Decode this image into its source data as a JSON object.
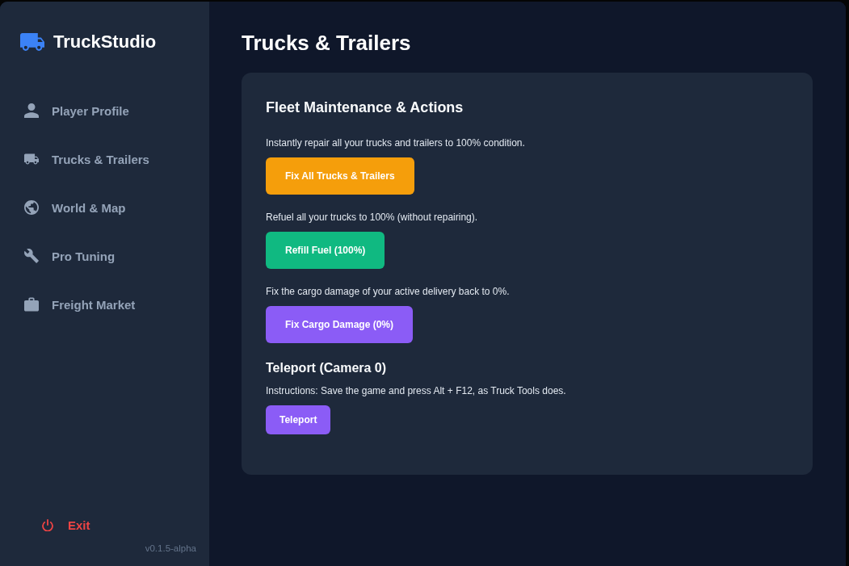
{
  "app": {
    "name": "TruckStudio",
    "version": "v0.1.5-alpha"
  },
  "sidebar": {
    "items": [
      {
        "label": "Player Profile",
        "selected": false
      },
      {
        "label": "Trucks & Trailers",
        "selected": false
      },
      {
        "label": "World & Map",
        "selected": false
      },
      {
        "label": "Pro Tuning",
        "selected": false
      },
      {
        "label": "Freight Market",
        "selected": false
      }
    ],
    "exit": {
      "label": "Exit"
    }
  },
  "page": {
    "title": "Trucks & Trailers"
  },
  "panel": {
    "sections": [
      {
        "kind": "main",
        "title": "Fleet Maintenance & Actions",
        "actions": [
          {
            "description": "Instantly repair all your trucks and trailers to 100% condition.",
            "button": "Fix All Trucks & Trailers",
            "color": "#f59e0b",
            "kind": "large"
          },
          {
            "description": "Refuel all your trucks to 100% (without repairing).",
            "button": "Refill Fuel (100%)",
            "color": "#10b981",
            "kind": "large"
          },
          {
            "description": "Fix the cargo damage of your active delivery back to 0%.",
            "button": "Fix Cargo Damage (0%)",
            "color": "#8b5cf6",
            "kind": "large"
          }
        ]
      },
      {
        "kind": "sub",
        "title": "Teleport (Camera 0)",
        "actions": [
          {
            "description": "Instructions: Save the game and press Alt + F12, as Truck Tools does.",
            "button": "Teleport",
            "color": "#8b5cf6",
            "kind": "small"
          }
        ]
      }
    ]
  }
}
